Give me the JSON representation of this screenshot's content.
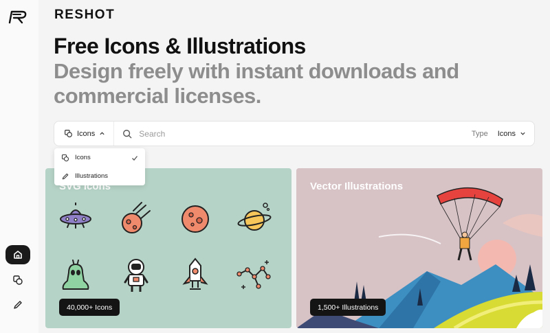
{
  "app": {
    "brand": "RESHOT"
  },
  "hero": {
    "title": "Free Icons & Illustrations",
    "subtitle": "Design freely with instant downloads and commercial licenses."
  },
  "search": {
    "type_selector": "Icons",
    "placeholder": "Search",
    "type_label": "Type",
    "type_value": "Icons"
  },
  "dropdown": {
    "items": [
      {
        "label": "Icons",
        "selected": true,
        "icon": "shapes-icon"
      },
      {
        "label": "Illustrations",
        "selected": false,
        "icon": "pencil-icon"
      }
    ]
  },
  "cards": {
    "icons": {
      "title": "SVG Icons",
      "badge": "40,000+ Icons"
    },
    "illustrations": {
      "title": "Vector Illustrations",
      "badge": "1,500+ Illustrations"
    }
  },
  "sidebar": {
    "items": [
      {
        "name": "home",
        "icon": "home-icon",
        "active": true
      },
      {
        "name": "icons",
        "icon": "shapes-icon",
        "active": false
      },
      {
        "name": "illustrations",
        "icon": "pencil-icon",
        "active": false
      }
    ]
  },
  "colors": {
    "icons_card_bg": "#b6d3c7",
    "illustrations_card_bg": "#d7c2c6",
    "subtitle_gray": "#8d8d8d",
    "icon_accent_red": "#f08a6c",
    "icon_accent_purple": "#8f80c8",
    "icon_accent_green": "#8fd3a3",
    "icon_accent_yellow": "#f7c65a"
  }
}
